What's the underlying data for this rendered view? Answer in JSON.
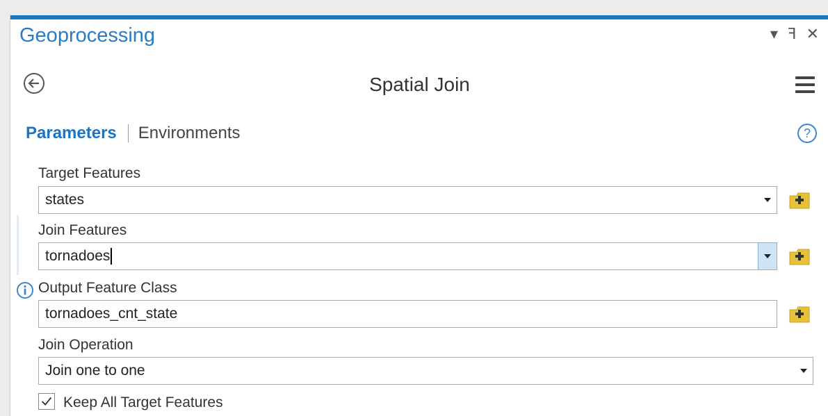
{
  "window": {
    "title": "Geoprocessing",
    "controls": {
      "menu": "▾",
      "pin": "ꟻ",
      "close": "✕"
    }
  },
  "header": {
    "tool_title": "Spatial Join"
  },
  "tabs": [
    {
      "label": "Parameters",
      "active": true
    },
    {
      "label": "Environments",
      "active": false
    }
  ],
  "parameters": {
    "target_features": {
      "label": "Target Features",
      "value": "states"
    },
    "join_features": {
      "label": "Join Features",
      "value": "tornadoes"
    },
    "output_feature_class": {
      "label": "Output Feature Class",
      "value": "tornadoes_cnt_state"
    },
    "join_operation": {
      "label": "Join Operation",
      "value": "Join one to one"
    },
    "keep_all_target_features": {
      "label": "Keep All Target Features",
      "checked": true
    }
  },
  "colors": {
    "accent": "#1b75c7",
    "add_icon": "#e6c23a"
  }
}
